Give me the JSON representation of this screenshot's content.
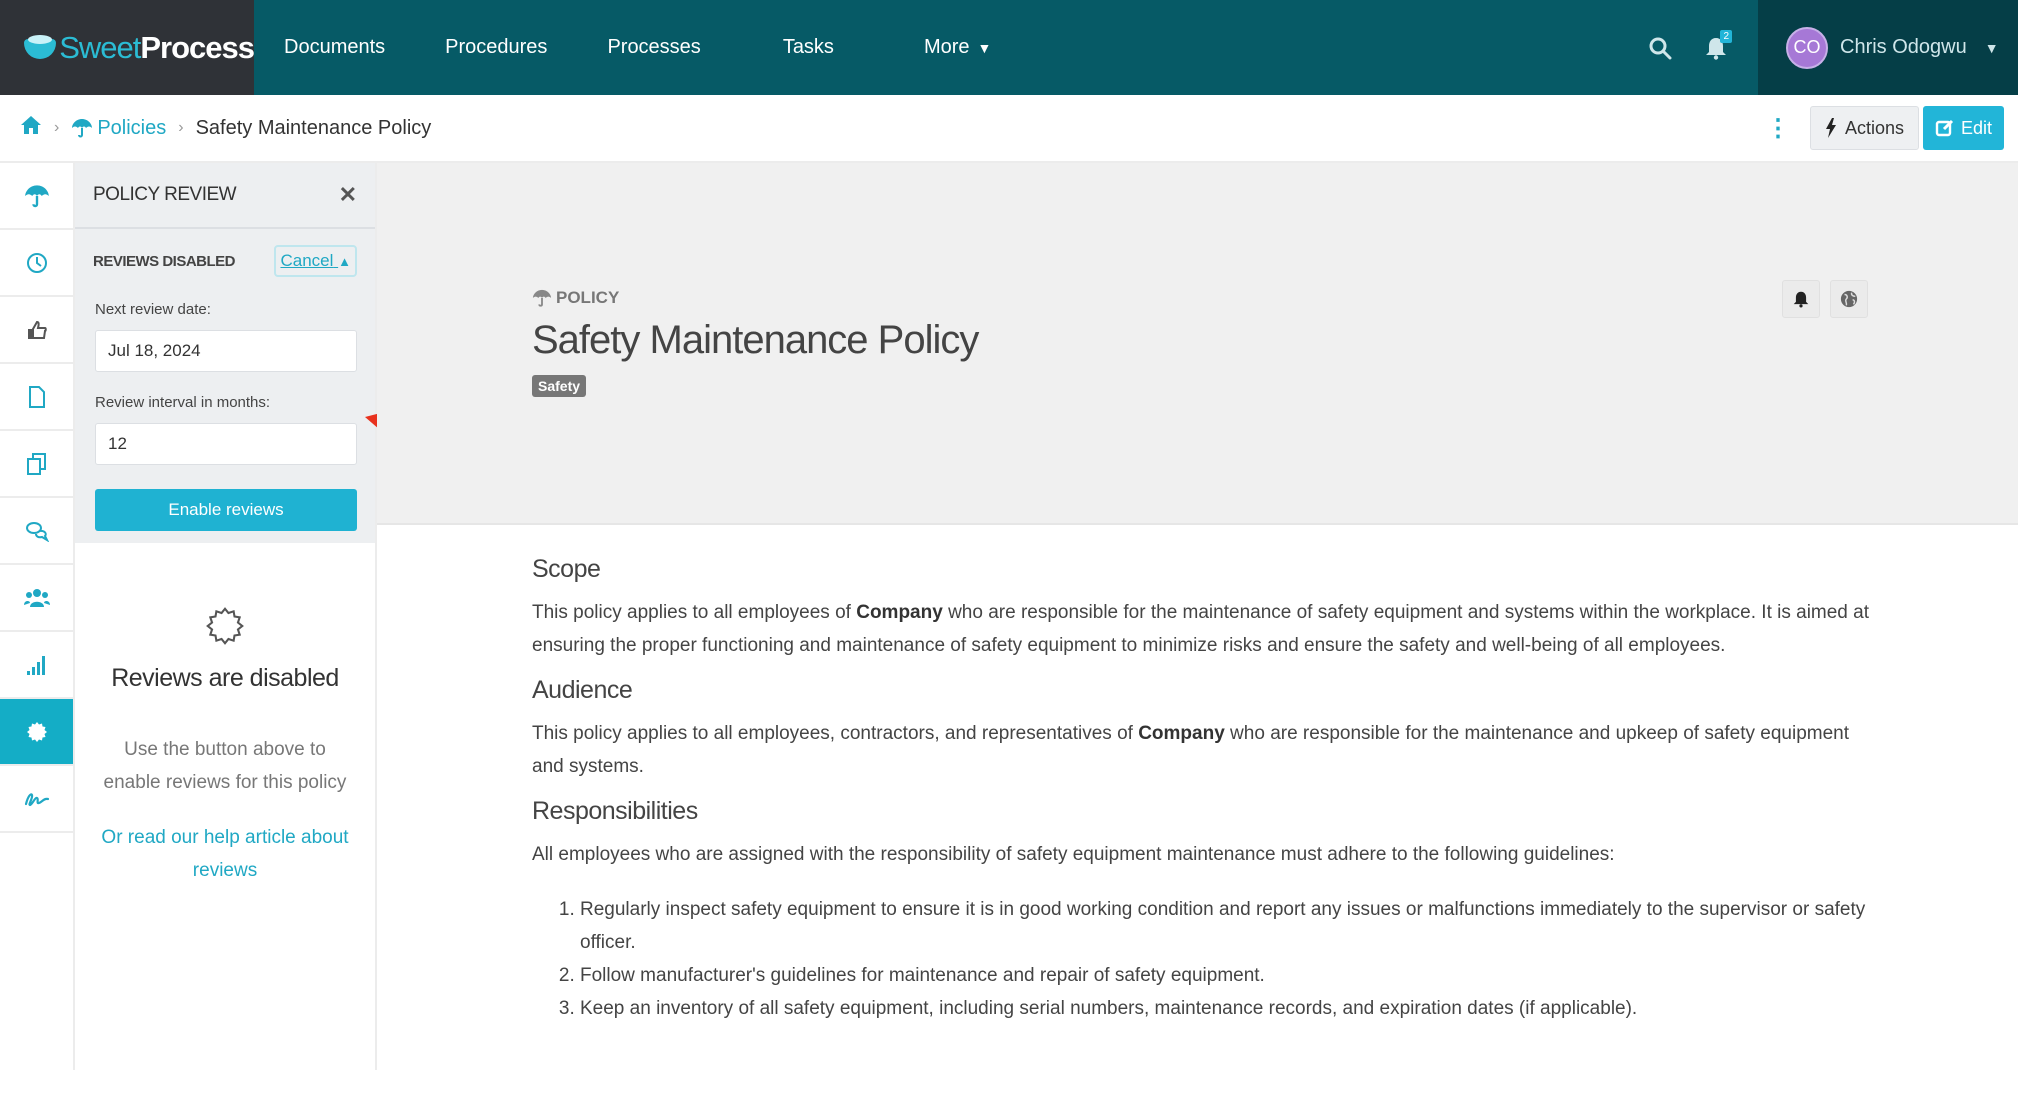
{
  "app": {
    "brand_part1": "Sweet",
    "brand_part2": "Process"
  },
  "nav": {
    "items": [
      {
        "label": "Documents"
      },
      {
        "label": "Procedures"
      },
      {
        "label": "Processes"
      },
      {
        "label": "Tasks"
      },
      {
        "label": "More"
      }
    ],
    "notification_count": "2",
    "user": {
      "initials": "CO",
      "name": "Chris Odogwu"
    }
  },
  "breadcrumb": {
    "parent": "Policies",
    "current": "Safety Maintenance Policy"
  },
  "toolbar": {
    "actions_label": "Actions",
    "edit_label": "Edit"
  },
  "rail": {
    "items": [
      {
        "icon": "umbrella-icon"
      },
      {
        "icon": "clock-icon"
      },
      {
        "icon": "thumbs-up-icon"
      },
      {
        "icon": "document-icon"
      },
      {
        "icon": "copy-icon"
      },
      {
        "icon": "comments-icon"
      },
      {
        "icon": "users-icon"
      },
      {
        "icon": "signal-bars-icon"
      },
      {
        "icon": "certificate-icon",
        "active": true
      },
      {
        "icon": "signature-icon"
      }
    ]
  },
  "panel": {
    "title": "POLICY REVIEW",
    "status": "REVIEWS DISABLED",
    "cancel_label": "Cancel",
    "next_review_label": "Next review date:",
    "next_review_value": "Jul 18, 2024",
    "interval_label": "Review interval in months:",
    "interval_value": "12",
    "enable_button": "Enable reviews",
    "disabled_title": "Reviews are disabled",
    "disabled_hint": "Use the button above to enable reviews for this policy",
    "help_link": "Or read our help article about reviews"
  },
  "policy": {
    "kicker": "POLICY",
    "title": "Safety Maintenance Policy",
    "tag": "Safety",
    "sections": {
      "scope": {
        "heading": "Scope",
        "text_before": "This policy applies to all employees of ",
        "bold": "Company",
        "text_after": " who are responsible for the maintenance of safety equipment and systems within the workplace. It is aimed at ensuring the proper functioning and maintenance of safety equipment to minimize risks and ensure the safety and well-being of all employees."
      },
      "audience": {
        "heading": "Audience",
        "text_before": "This policy applies to all employees, contractors, and representatives of ",
        "bold": "Company",
        "text_after": " who are responsible for the maintenance and upkeep of safety equipment and systems."
      },
      "responsibilities": {
        "heading": "Responsibilities",
        "intro": "All employees who are assigned with the responsibility of safety equipment maintenance must adhere to the following guidelines:",
        "items": [
          "Regularly inspect safety equipment to ensure it is in good working condition and report any issues or malfunctions immediately to the supervisor or safety officer.",
          "Follow manufacturer's guidelines for maintenance and repair of safety equipment.",
          "Keep an inventory of all safety equipment, including serial numbers, maintenance records, and expiration dates (if applicable)."
        ]
      }
    }
  },
  "colors": {
    "nav_bg": "#065a66",
    "logo_bg": "#2f3237",
    "accent": "#20a8c4",
    "annotation_arrow": "#e8321e"
  }
}
